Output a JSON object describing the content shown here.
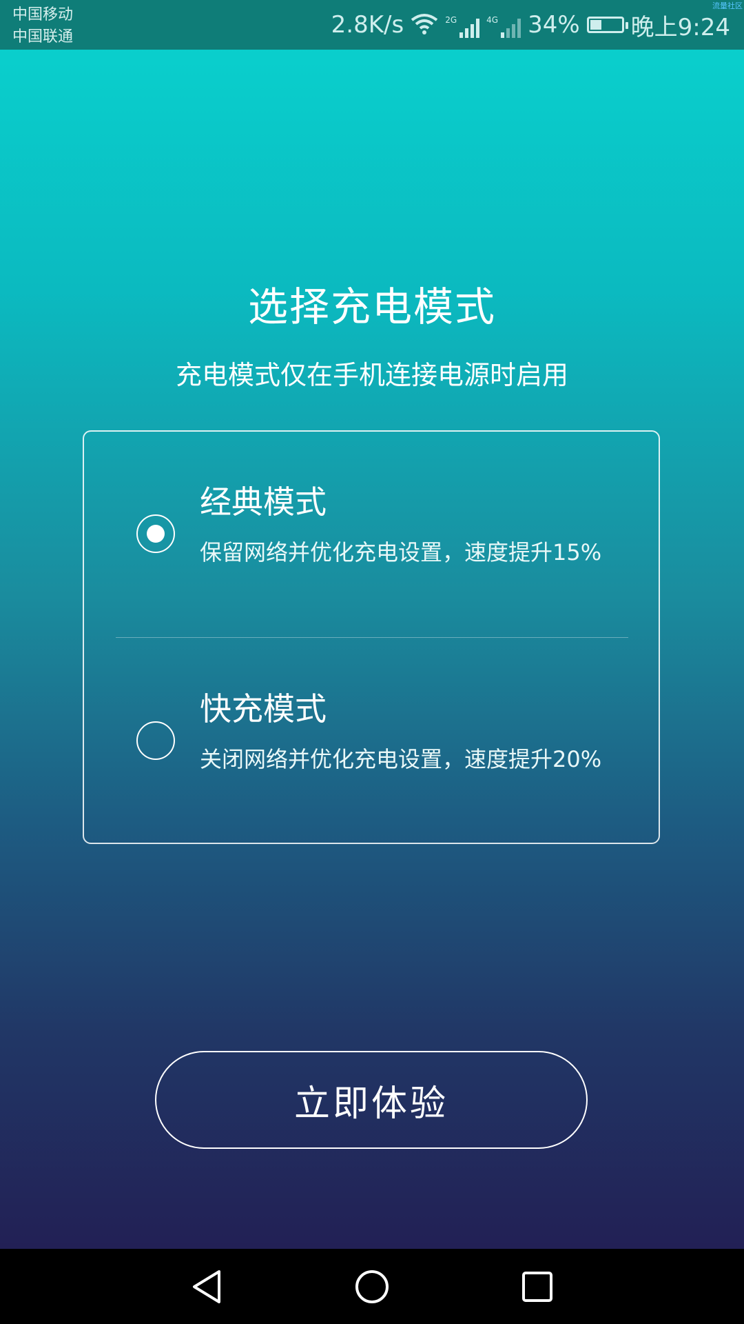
{
  "status_bar": {
    "carrier1": "中国移动",
    "carrier2": "中国联通",
    "speed": "2.8K/s",
    "net1": "2G",
    "net2": "4G",
    "battery": "34%",
    "time": "晚上9:24",
    "corner_text": "流量社区"
  },
  "header": {
    "title": "选择充电模式",
    "subtitle": "充电模式仅在手机连接电源时启用"
  },
  "options": [
    {
      "title": "经典模式",
      "desc": "保留网络并优化充电设置，速度提升15%",
      "selected": true
    },
    {
      "title": "快充模式",
      "desc": "关闭网络并优化充电设置，速度提升20%",
      "selected": false
    }
  ],
  "cta": {
    "label": "立即体验"
  },
  "icons": {
    "back": "back-icon",
    "home": "home-icon",
    "recent": "recent-apps-icon"
  }
}
